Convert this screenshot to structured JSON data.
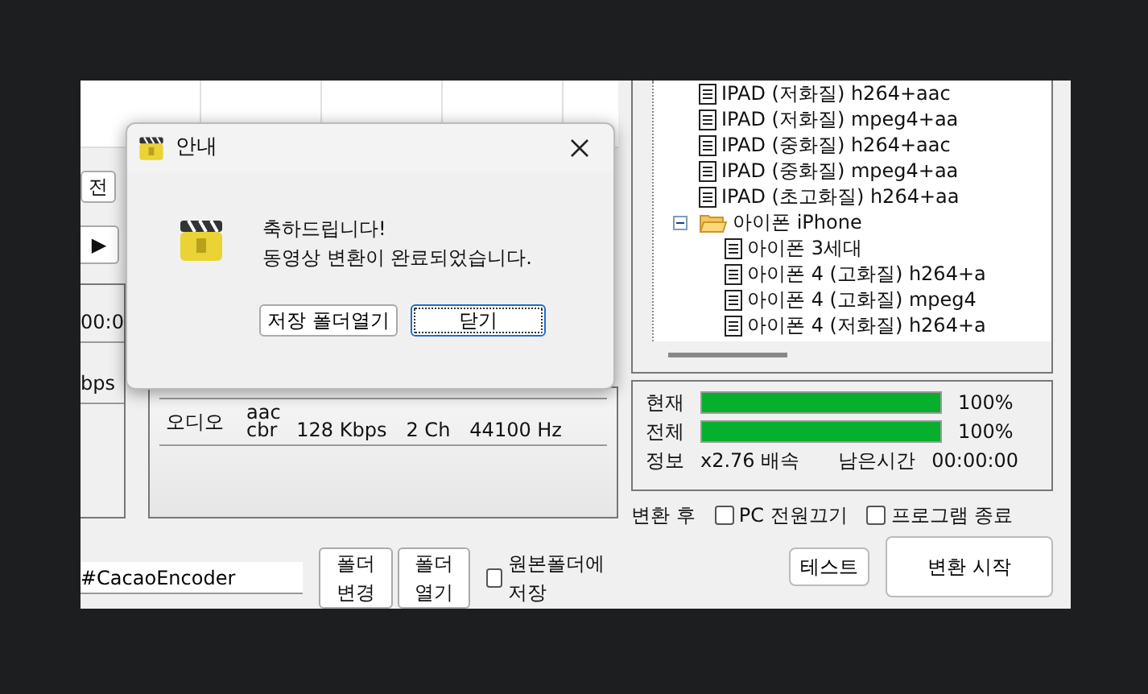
{
  "left_panel": {
    "partial_button": "전",
    "play_button": "▶",
    "time": "00:0",
    "bitrate": "bps"
  },
  "info_panel": {
    "audio_label": "오디오",
    "audio_codec": "aac",
    "audio_details": [
      "cbr",
      "128 Kbps",
      "2 Ch",
      "44100 Hz"
    ]
  },
  "output": {
    "path": "#CacaoEncoder",
    "buttons": [
      "폴더변경",
      "폴더열기"
    ],
    "save_in_source": {
      "label": "원본폴더에 저장",
      "checked": false
    }
  },
  "tree": [
    {
      "label": "IPAD (저화질) h264+aac",
      "kind": "file"
    },
    {
      "label": "IPAD (저화질) mpeg4+aa",
      "kind": "file"
    },
    {
      "label": "IPAD (중화질) h264+aac",
      "kind": "file"
    },
    {
      "label": "IPAD (중화질) mpeg4+aa",
      "kind": "file"
    },
    {
      "label": "IPAD (초고화질) h264+aa",
      "kind": "file"
    },
    {
      "label": "아이폰 iPhone",
      "kind": "folder",
      "expanded": true,
      "children": [
        {
          "label": "아이폰 3세대",
          "kind": "file"
        },
        {
          "label": "아이폰 4 (고화질) h264+a",
          "kind": "file"
        },
        {
          "label": "아이폰 4 (고화질) mpeg4",
          "kind": "file"
        },
        {
          "label": "아이폰 4 (저화질) h264+a",
          "kind": "file"
        }
      ]
    }
  ],
  "progress": [
    {
      "label": "현재",
      "level": 1,
      "reading": "100%"
    },
    {
      "label": "전체",
      "level": 1,
      "reading": "100%"
    }
  ],
  "info": {
    "label": "정보",
    "speed": "x2.76 배속",
    "remaining_label": "남은시간",
    "remaining": "00:00:00"
  },
  "after_conversion": {
    "label": "변환 후",
    "options": [
      {
        "label": "PC 전원끄기",
        "checked": false
      },
      {
        "label": "프로그램 종료",
        "checked": false
      }
    ]
  },
  "actions": [
    "테스트",
    "변환 시작"
  ],
  "dialog": {
    "title": "안내",
    "message": [
      "축하드립니다!",
      "동영상 변환이 완료되었습니다."
    ],
    "buttons": [
      {
        "label": "저장 폴더열기",
        "focused": false
      },
      {
        "label": "닫기",
        "focused": true
      }
    ]
  }
}
